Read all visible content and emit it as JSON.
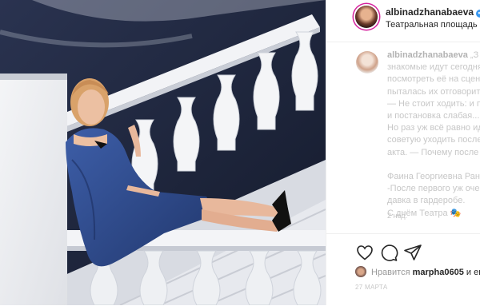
{
  "post": {
    "username": "albinadzhanabaeva",
    "verified_mark": "✔",
    "separator": "•",
    "location": "Театральная площадь"
  },
  "caption": {
    "username": "albinadzhanabaeva",
    "lines": [
      " „З",
      "знакомые идут сегодня",
      "посмотреть её на сцене",
      "пыталась их отговорить",
      "— Не стоит ходить: и п",
      "и постановка слабая...",
      "Но раз уж всё равно ид",
      "советую уходить после",
      "акта. — Почему после",
      "",
      "Фаина Георгиевна Ране",
      "-После первого уж очен",
      "давка в гардеробе.",
      "С днём Театра 🎭"
    ],
    "time": "2 нед."
  },
  "actions": {
    "like_icon": "heart-icon",
    "comment_icon": "comment-icon",
    "share_icon": "share-icon"
  },
  "likes": {
    "prefix": "Нравится",
    "user": "marpha0605",
    "suffix": "и ещ"
  },
  "date": "27 МАРТА",
  "colors": {
    "verified": "#3897f0",
    "dress": "#2e4a8c",
    "stairs": "#ecedf0"
  }
}
